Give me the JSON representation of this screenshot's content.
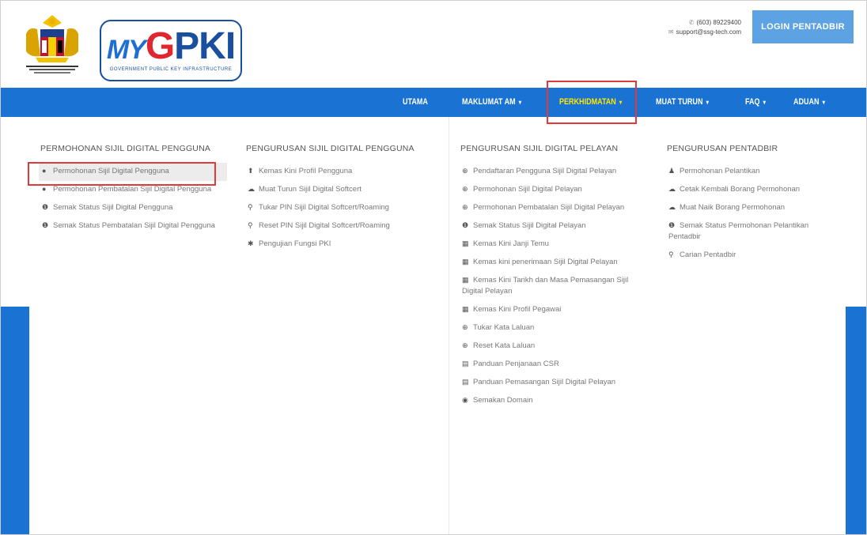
{
  "contact": {
    "phone": "(603) 89229400",
    "email": "support@ssg-tech.com"
  },
  "login_label": "LOGIN PENTADBIR",
  "logo": {
    "my": "MY",
    "g": "G",
    "pki": "PKI",
    "tagline": "GOVERNMENT PUBLIC KEY INFRASTRUCTURE"
  },
  "nav": {
    "items": [
      {
        "label": "UTAMA",
        "caret": ""
      },
      {
        "label": "MAKLUMAT AM",
        "caret": "▾"
      },
      {
        "label": "PERKHIDMATAN",
        "caret": "▾"
      },
      {
        "label": "MUAT TURUN",
        "caret": "▾"
      },
      {
        "label": "FAQ",
        "caret": "▾"
      },
      {
        "label": "ADUAN",
        "caret": "▾"
      }
    ]
  },
  "menu": {
    "columns": [
      {
        "title": "PERMOHONAN SIJIL DIGITAL PENGGUNA",
        "items": [
          {
            "icon": "●",
            "label": "Permohonan Sijil Digital Pengguna"
          },
          {
            "icon": "●",
            "label": "Permohonan Pembatalan Sijil Digital Pengguna"
          },
          {
            "icon": "❶",
            "label": "Semak Status Sijil Digital Pengguna"
          },
          {
            "icon": "❶",
            "label": "Semak Status Pembatalan Sijil Digital Pengguna"
          }
        ]
      },
      {
        "title": "PENGURUSAN SIJIL DIGITAL PENGGUNA",
        "items": [
          {
            "icon": "⬆",
            "label": "Kemas Kini Profil Pengguna"
          },
          {
            "icon": "☁",
            "label": "Muat Turun Sijil Digital Softcert"
          },
          {
            "icon": "⚲",
            "label": "Tukar PIN Sijil Digital Softcert/Roaming"
          },
          {
            "icon": "⚲",
            "label": "Reset PIN Sijil Digital Softcert/Roaming"
          },
          {
            "icon": "✱",
            "label": "Pengujian Fungsi PKI"
          }
        ]
      },
      {
        "title": "PENGURUSAN SIJIL DIGITAL PELAYAN",
        "items": [
          {
            "icon": "⊕",
            "label": "Pendaftaran Pengguna Sijil Digital Pelayan"
          },
          {
            "icon": "⊕",
            "label": "Permohonan Sijil Digital Pelayan"
          },
          {
            "icon": "⊕",
            "label": "Permohonan Pembatalan Sijil Digital Pelayan"
          },
          {
            "icon": "❶",
            "label": "Semak Status Sijil Digital Pelayan"
          },
          {
            "icon": "▦",
            "label": "Kemas Kini Janji Temu"
          },
          {
            "icon": "▦",
            "label": "Kemas kini penerimaan Sijil Digital Pelayan"
          },
          {
            "icon": "▦",
            "label": "Kemas Kini Tarikh dan Masa Pemasangan Sijil Digital Pelayan"
          },
          {
            "icon": "▦",
            "label": "Kemas Kini Profil Pegawai"
          },
          {
            "icon": "⊕",
            "label": "Tukar Kata Laluan"
          },
          {
            "icon": "⊕",
            "label": "Reset Kata Laluan"
          },
          {
            "icon": "▤",
            "label": "Panduan Penjanaan CSR"
          },
          {
            "icon": "▤",
            "label": "Panduan Pemasangan Sijil Digital Pelayan"
          },
          {
            "icon": "◉",
            "label": "Semakan Domain"
          }
        ]
      },
      {
        "title": "PENGURUSAN PENTADBIR",
        "items": [
          {
            "icon": "♟",
            "label": "Permohonan Pelantikan"
          },
          {
            "icon": "☁",
            "label": "Cetak Kembali Borang Permohonan"
          },
          {
            "icon": "☁",
            "label": "Muat Naik Borang Permohonan"
          },
          {
            "icon": "❶",
            "label": "Semak Status Permohonan Pelantikan Pentadbir"
          },
          {
            "icon": "⚲",
            "label": "Carian Pentadbir"
          }
        ]
      }
    ]
  }
}
